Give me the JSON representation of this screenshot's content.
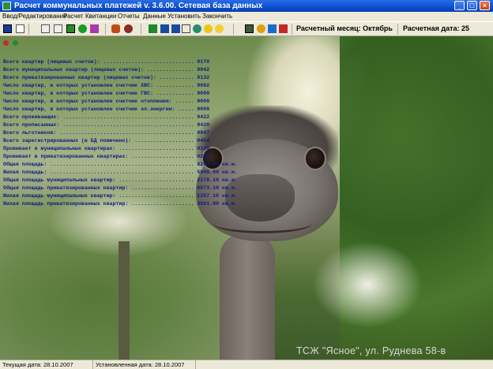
{
  "window": {
    "title": "Расчет коммунальных платежей v. 3.6.00. Сетевая база данных"
  },
  "menu": [
    "Ввод/Редактирование",
    "Расчет",
    "Квитанции",
    "Отчеты",
    "Данные",
    "Установить",
    "Закончить"
  ],
  "toolbar": {
    "month_label": "Расчетный месяц: Октябрь",
    "date_label": "Расчетная дата: 25"
  },
  "stats": [
    {
      "label": "Всего квартир (лицевых счетов):",
      "value": "0170"
    },
    {
      "label": "Всего муниципальных квартир (лицевых счетов):",
      "value": "0042"
    },
    {
      "label": "Всего приватизированных квартир (лицевых счетов):",
      "value": "0132"
    },
    {
      "label": "Число квартир, в которых установлен счетчик ХВС:",
      "value": "0002"
    },
    {
      "label": "Число квартир, в которых установлен счетчик ГВС:",
      "value": "0000"
    },
    {
      "label": "Число квартир, в которых установлен счетчик отопления:",
      "value": "0000"
    },
    {
      "label": "Число квартир, в которых установлен счетчик эл.энергии:",
      "value": "0000"
    },
    {
      "label": "Всего проживающих:",
      "value": "0422"
    },
    {
      "label": "Всего прописанных:",
      "value": "0420"
    },
    {
      "label": "Всего льготников:",
      "value": "0047"
    },
    {
      "label": "Всего зарегистрированных (в БД помечено):",
      "value": "0454"
    },
    {
      "label": "Проживает в муниципальных квартирах:",
      "value": "0120"
    },
    {
      "label": "Проживает в приватизированных квартирах:",
      "value": "0289"
    },
    {
      "label": "Общая площадь:",
      "value": "8249.20 кв.м."
    },
    {
      "label": "Жилая площадь:",
      "value": "5049.00 кв.м."
    },
    {
      "label": "Общая площадь муниципальных квартир:",
      "value": "2176.10 кв.м."
    },
    {
      "label": "Общая площадь приватизированных квартир:",
      "value": "6073.10 кв.м."
    },
    {
      "label": "Жилая площадь муниципальных квартир:",
      "value": "1357.10 кв.м."
    },
    {
      "label": "Жилая площадь приватизированных квартир:",
      "value": "3691.90 кв.м."
    }
  ],
  "watermark": "ТСЖ \"Ясное\",  ул. Руднева 58-в",
  "status": {
    "current_date": "Текущая дата: 28.10.2007",
    "set_date": "Установленная дата: 28.10.2007"
  },
  "colors": {
    "title_bar": "#0a4ed0",
    "stats_text": "#0a1a8a",
    "window_bg": "#ece9d8"
  }
}
